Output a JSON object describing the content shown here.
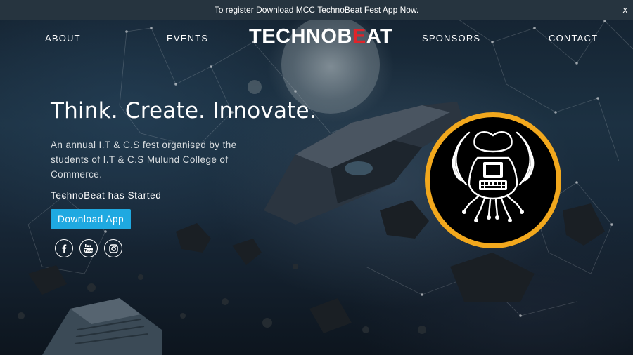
{
  "announcement": {
    "text": "To register Download MCC TechnoBeat Fest App Now.",
    "close": "x"
  },
  "nav": {
    "about": "ABOUT",
    "events": "EVENTS",
    "logo_pre": "TECHNOB",
    "logo_accent": "E",
    "logo_post": "AT",
    "sponsors": "SPONSORS",
    "contact": "CONTACT"
  },
  "hero": {
    "title": "Think. Create. Innovate.",
    "description": "An annual I.T & C.S fest organised by the students of I.T & C.S Mulund College of Commerce.",
    "status": "TechnoBeat has Started",
    "button": "Download App"
  },
  "social": [
    "facebook-icon",
    "youtube-icon",
    "instagram-icon"
  ],
  "colors": {
    "accent_red": "#e0242a",
    "button_blue": "#1fa9e1",
    "emblem_ring": "#f2a81d",
    "topbar": "#26343f"
  }
}
